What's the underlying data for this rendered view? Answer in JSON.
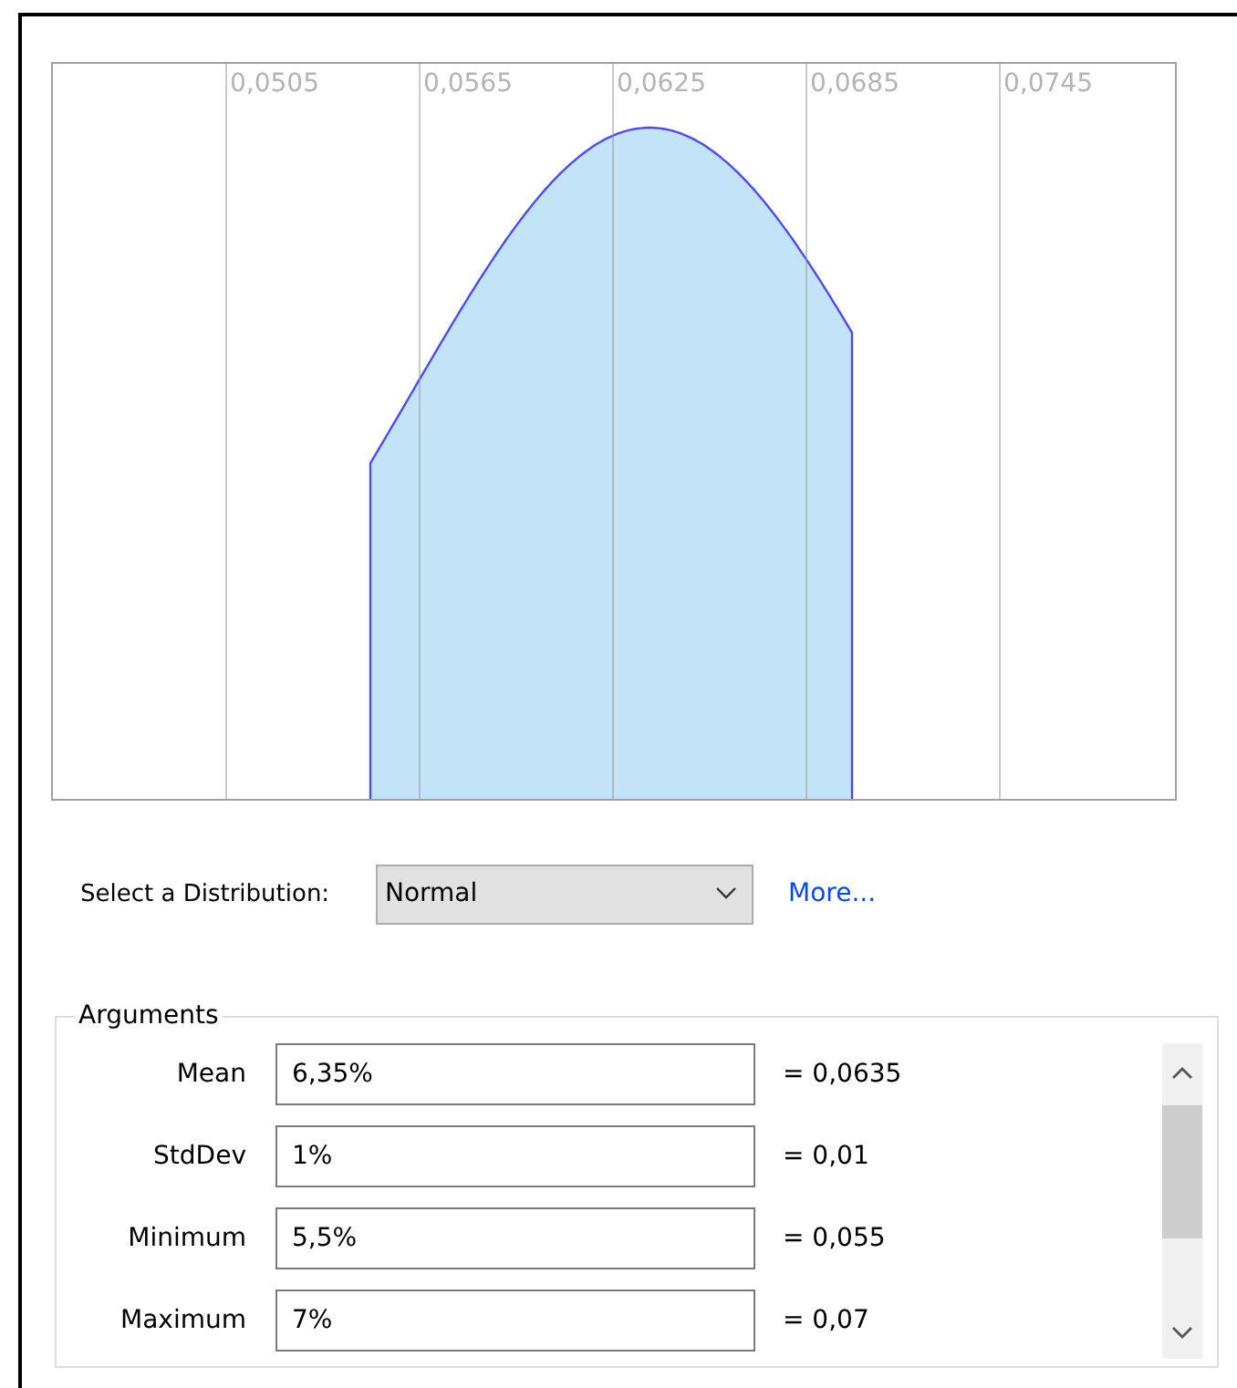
{
  "chart": {
    "x_tick_labels": [
      "0,0505",
      "0,0565",
      "0,0625",
      "0,0685",
      "0,0745"
    ]
  },
  "distribution": {
    "label": "Select a Distribution:",
    "value": "Normal",
    "more_link": "More..."
  },
  "arguments": {
    "title": "Arguments",
    "rows": [
      {
        "label": "Mean",
        "value": "6,35%",
        "result": "= 0,0635"
      },
      {
        "label": "StdDev",
        "value": "1%",
        "result": "= 0,01"
      },
      {
        "label": "Minimum",
        "value": "5,5%",
        "result": "= 0,055"
      },
      {
        "label": "Maximum",
        "value": "7%",
        "result": "= 0,07"
      }
    ]
  }
}
